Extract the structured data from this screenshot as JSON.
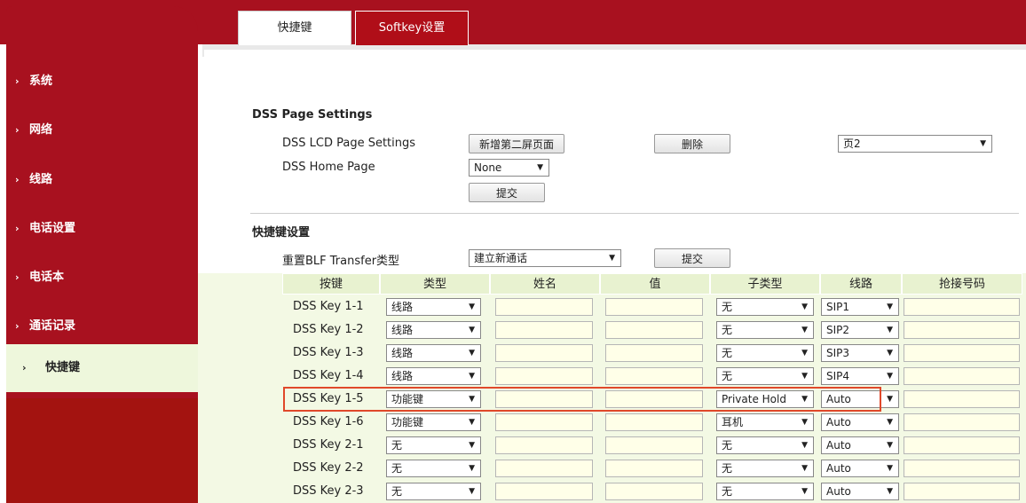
{
  "sidebar": {
    "items": [
      {
        "label": "系统"
      },
      {
        "label": "网络"
      },
      {
        "label": "线路"
      },
      {
        "label": "电话设置"
      },
      {
        "label": "电话本"
      },
      {
        "label": "通话记录"
      },
      {
        "label": "快捷键"
      }
    ]
  },
  "tabs": [
    {
      "label": "快捷键"
    },
    {
      "label": "Softkey设置"
    }
  ],
  "dss_page": {
    "heading": "DSS Page Settings",
    "lcd_label": "DSS LCD Page Settings",
    "add_button": "新增第二屏页面",
    "delete_button": "删除",
    "page_select": "页2",
    "home_label": "DSS Home Page",
    "home_select": "None",
    "submit": "提交"
  },
  "keys": {
    "heading": "快捷键设置",
    "blf_label": "重置BLF Transfer类型",
    "blf_select": "建立新通话",
    "submit": "提交",
    "columns": [
      "按键",
      "类型",
      "姓名",
      "值",
      "子类型",
      "线路",
      "抢接号码"
    ],
    "rows": [
      {
        "key": "DSS Key 1-1",
        "type": "线路",
        "subtype": "无",
        "line": "SIP1"
      },
      {
        "key": "DSS Key 1-2",
        "type": "线路",
        "subtype": "无",
        "line": "SIP2"
      },
      {
        "key": "DSS Key 1-3",
        "type": "线路",
        "subtype": "无",
        "line": "SIP3"
      },
      {
        "key": "DSS Key 1-4",
        "type": "线路",
        "subtype": "无",
        "line": "SIP4"
      },
      {
        "key": "DSS Key 1-5",
        "type": "功能键",
        "subtype": "Private Hold",
        "line": "Auto"
      },
      {
        "key": "DSS Key 1-6",
        "type": "功能键",
        "subtype": "耳机",
        "line": "Auto"
      },
      {
        "key": "DSS Key 2-1",
        "type": "无",
        "subtype": "无",
        "line": "Auto"
      },
      {
        "key": "DSS Key 2-2",
        "type": "无",
        "subtype": "无",
        "line": "Auto"
      },
      {
        "key": "DSS Key 2-3",
        "type": "无",
        "subtype": "无",
        "line": "Auto"
      }
    ]
  },
  "colors": {
    "brand": "#a8111f",
    "highlight": "#e0482a",
    "input_bg": "#ffffe8",
    "table_bg": "#f3f9e4"
  }
}
